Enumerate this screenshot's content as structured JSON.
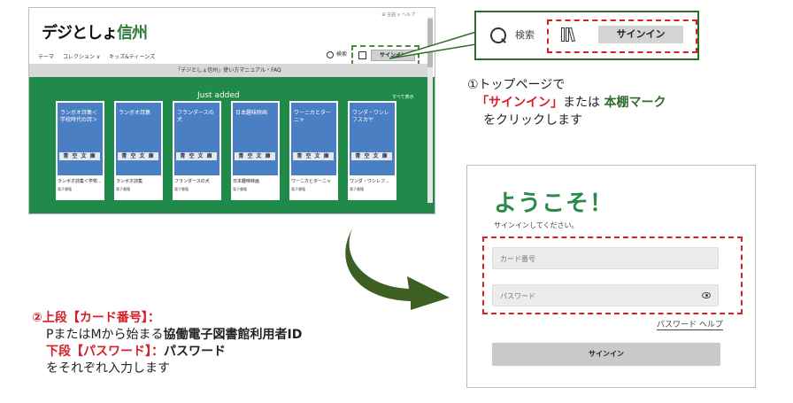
{
  "browser": {
    "logo_part1": "デジとしょ",
    "logo_part2": "信州",
    "top_links": "⊞ 言語 ∨  ヘルプ",
    "nav": [
      "テーマ",
      "コレクション ∨",
      "キッズ&ティーンズ"
    ],
    "search_label": "検索",
    "signin_label": "サインイン",
    "banner": "「デジとしょ信州」使い方マニュアル・FAQ",
    "section_title": "Just added",
    "see_all": "すべて表示",
    "cards": [
      {
        "cover": "ランボオ詩集＜学校時代の詩＞",
        "cover_band": "青 空 文 庫",
        "name": "ランボオ詩集＜学校...",
        "meta": "電子書籍"
      },
      {
        "cover": "ランボオ詩集",
        "cover_band": "青 空 文 庫",
        "name": "ランボオ詩集",
        "meta": "電子書籍"
      },
      {
        "cover": "フランダースの犬",
        "cover_band": "青 空 文 庫",
        "name": "フランダースの犬",
        "meta": "電子書籍"
      },
      {
        "cover": "日本趣味映画",
        "cover_band": "青 空 文 庫",
        "name": "日本趣味映画",
        "meta": "電子書籍"
      },
      {
        "cover": "ワーニカとターニャ",
        "cover_band": "青 空 文 庫",
        "name": "ワーニカとターニャ",
        "meta": "電子書籍"
      },
      {
        "cover": "ワンダ・ワシレフスカヤ",
        "cover_band": "青 空 文 庫",
        "name": "ワンダ・ワシレフ...",
        "meta": "電子書籍"
      }
    ]
  },
  "zoom": {
    "search_label": "検索",
    "signin_label": "サインイン"
  },
  "step1": {
    "line1": "①トップページで",
    "line2_a": "「サインイン」",
    "line2_b": "または",
    "line2_c": "本棚マーク",
    "line3": "をクリックします"
  },
  "signin_panel": {
    "welcome": "ようこそ！",
    "subtitle": "サインインしてください。",
    "card_placeholder": "カード番号",
    "password_placeholder": "パスワード",
    "password_help": "パスワード ヘルプ",
    "signin_button": "サインイン"
  },
  "step2": {
    "line1": "②上段【カード番号】：",
    "line2_a": "PまたはMから始まる",
    "line2_b": "協働電子図書館利用者ID",
    "line3_a": "下段【パスワード】：",
    "line3_b": "パスワード",
    "line4": "をそれぞれ入力します"
  },
  "colors": {
    "green_band": "#1f8a4a",
    "highlight_red": "#d61f2a",
    "callout_green": "#2f6b2a",
    "welcome_green": "#2a8a4a"
  }
}
